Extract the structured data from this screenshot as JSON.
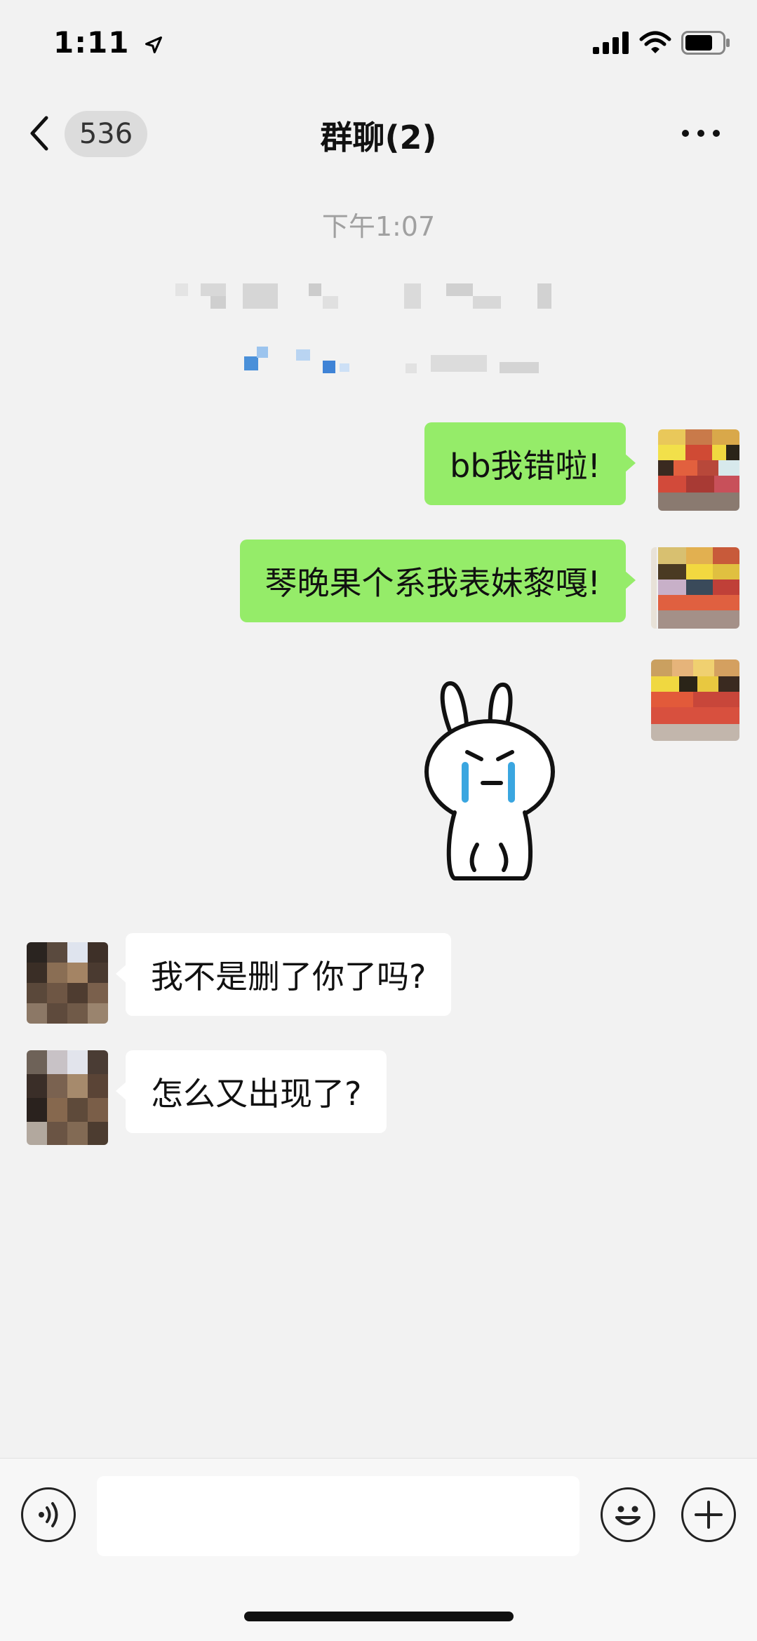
{
  "status_bar": {
    "time": "1:11",
    "location_icon": "location-arrow-icon",
    "signal_icon": "cellular-signal-icon",
    "wifi_icon": "wifi-icon",
    "battery_icon": "battery-icon"
  },
  "nav": {
    "back_icon": "chevron-left-icon",
    "unread_count": "536",
    "title": "群聊(2)",
    "more_icon": "more-dots-icon"
  },
  "chat": {
    "timestamp": "下午1:07",
    "messages": [
      {
        "side": "me",
        "text": "bb我错啦!"
      },
      {
        "side": "me",
        "text": "琴晚果个系我表妹黎嘎!"
      },
      {
        "side": "me",
        "type": "sticker",
        "sticker": "crying-rabbit-sticker"
      },
      {
        "side": "them",
        "text": "我不是删了你了吗?"
      },
      {
        "side": "them",
        "text": "怎么又出现了?"
      }
    ]
  },
  "input_bar": {
    "voice_icon": "voice-icon",
    "emoji_icon": "emoji-icon",
    "plus_icon": "plus-icon",
    "input_value": ""
  },
  "colors": {
    "background": "#f2f2f2",
    "my_bubble": "#95ec69",
    "their_bubble": "#ffffff"
  }
}
